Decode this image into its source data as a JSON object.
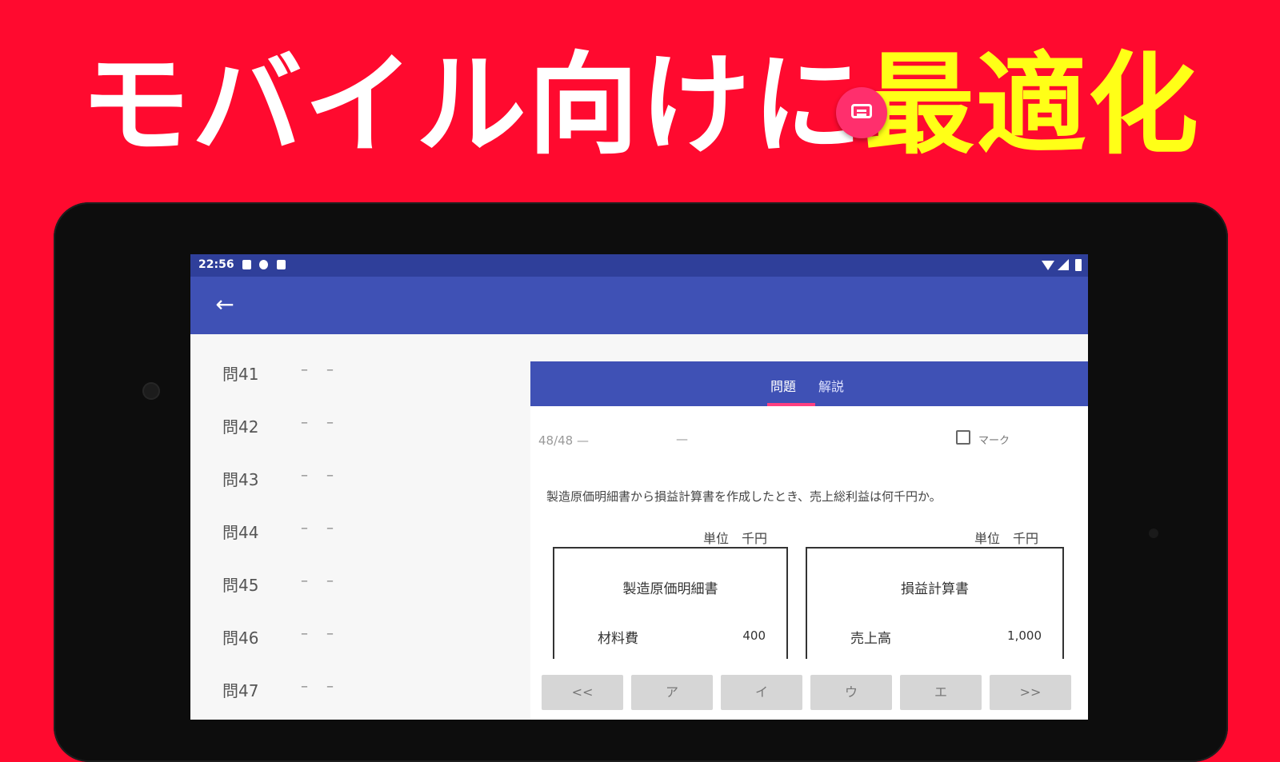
{
  "headline": {
    "part1": "モバイル向けに",
    "part2": "最適化"
  },
  "status_bar": {
    "time": "22:56"
  },
  "question_list": [
    {
      "label": "問41",
      "d1": "–",
      "d2": "–"
    },
    {
      "label": "問42",
      "d1": "–",
      "d2": "–"
    },
    {
      "label": "問43",
      "d1": "–",
      "d2": "–"
    },
    {
      "label": "問44",
      "d1": "–",
      "d2": "–"
    },
    {
      "label": "問45",
      "d1": "–",
      "d2": "–"
    },
    {
      "label": "問46",
      "d1": "–",
      "d2": "–"
    },
    {
      "label": "問47",
      "d1": "–",
      "d2": "–"
    }
  ],
  "tabs": [
    {
      "label": "問題"
    },
    {
      "label": "解説"
    }
  ],
  "detail": {
    "progress": "48/48 —",
    "dash": "—",
    "mark_label": "マーク",
    "question_text": "製造原価明細書から損益計算書を作成したとき、売上総利益は何千円か。",
    "statement_left": {
      "unit": "単位　千円",
      "title": "製造原価明細書",
      "row_label": "材料費",
      "row_value": "400"
    },
    "statement_right": {
      "unit": "単位　千円",
      "title": "損益計算書",
      "row_label": "売上高",
      "row_value": "1,000"
    }
  },
  "answer_buttons": [
    "<<",
    "ア",
    "イ",
    "ウ",
    "エ",
    ">>"
  ],
  "colors": {
    "background": "#ff0a2f",
    "headline_accent": "#ffff17",
    "primary": "#3f51b5",
    "status_bar": "#2f3f9a",
    "fab": "#ff2f6d"
  },
  "icons": {
    "back": "arrow-left-icon",
    "fab": "chat-icon"
  }
}
